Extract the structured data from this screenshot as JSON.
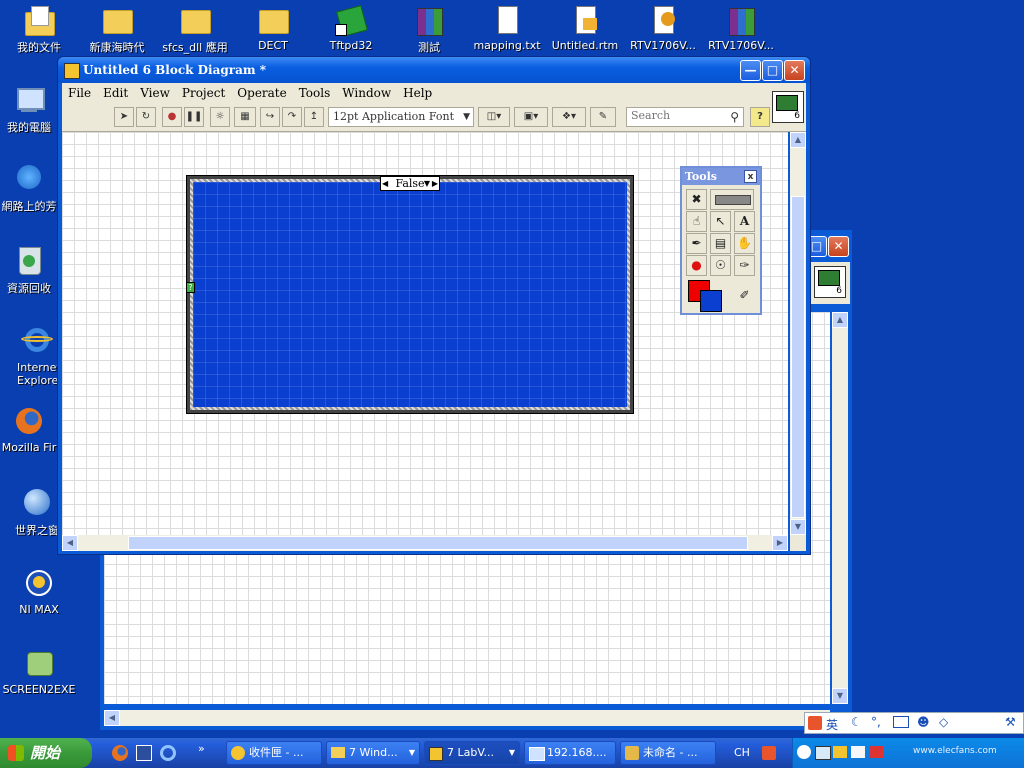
{
  "desktop": {
    "top_icons": [
      {
        "label": "我的文件",
        "icon": "my-documents-icon"
      },
      {
        "label": "新康海時代",
        "icon": "folder-icon"
      },
      {
        "label": "sfcs_dll 應用",
        "icon": "folder-icon"
      },
      {
        "label": "DECT",
        "icon": "folder-icon"
      },
      {
        "label": "Tftpd32",
        "icon": "tftpd-shortcut-icon"
      },
      {
        "label": "測試",
        "icon": "archive-icon"
      },
      {
        "label": "mapping.txt",
        "icon": "text-file-icon"
      },
      {
        "label": "Untitled.rtm",
        "icon": "rtm-file-icon"
      },
      {
        "label": "RTV1706V...",
        "icon": "settings-file-icon"
      },
      {
        "label": "RTV1706V...",
        "icon": "archive-icon"
      }
    ],
    "left_icons": [
      {
        "label": "我的電腦",
        "icon": "my-computer-icon"
      },
      {
        "label": "網路上的芳",
        "icon": "network-places-icon"
      },
      {
        "label": "資源回收",
        "icon": "recycle-bin-icon"
      },
      {
        "label": "Internet Explore",
        "icon": "internet-explorer-icon"
      },
      {
        "label": "Mozilla Fir",
        "icon": "firefox-icon"
      },
      {
        "label": "世界之窗",
        "icon": "browser-globe-icon"
      },
      {
        "label": "NI MAX",
        "icon": "ni-max-icon"
      },
      {
        "label": "SCREEN2EXE",
        "icon": "screen2exe-icon"
      }
    ]
  },
  "window": {
    "title": "Untitled 6 Block Diagram *",
    "vi_icon_number": "6",
    "menu": [
      "File",
      "Edit",
      "View",
      "Project",
      "Operate",
      "Tools",
      "Window",
      "Help"
    ],
    "font_select": "12pt Application Font",
    "search_placeholder": "Search",
    "help_label": "?"
  },
  "case_structure": {
    "selector_value": "False",
    "selector_terminal": "?",
    "fill_color": "#0a3fd0"
  },
  "tools_palette": {
    "title": "Tools",
    "close_label": "x"
  },
  "back_window": {
    "vi_icon_number": "6"
  },
  "taskbar": {
    "start_label": "開始",
    "tasks": [
      {
        "label": "收件匣 - ..."
      },
      {
        "label": "7 Wind..."
      },
      {
        "label": "7 LabV..."
      },
      {
        "label": "192.168...."
      },
      {
        "label": "未命名 - ..."
      }
    ],
    "lang": "CH",
    "ime_label": "英"
  },
  "watermark": "www.elecfans.com"
}
